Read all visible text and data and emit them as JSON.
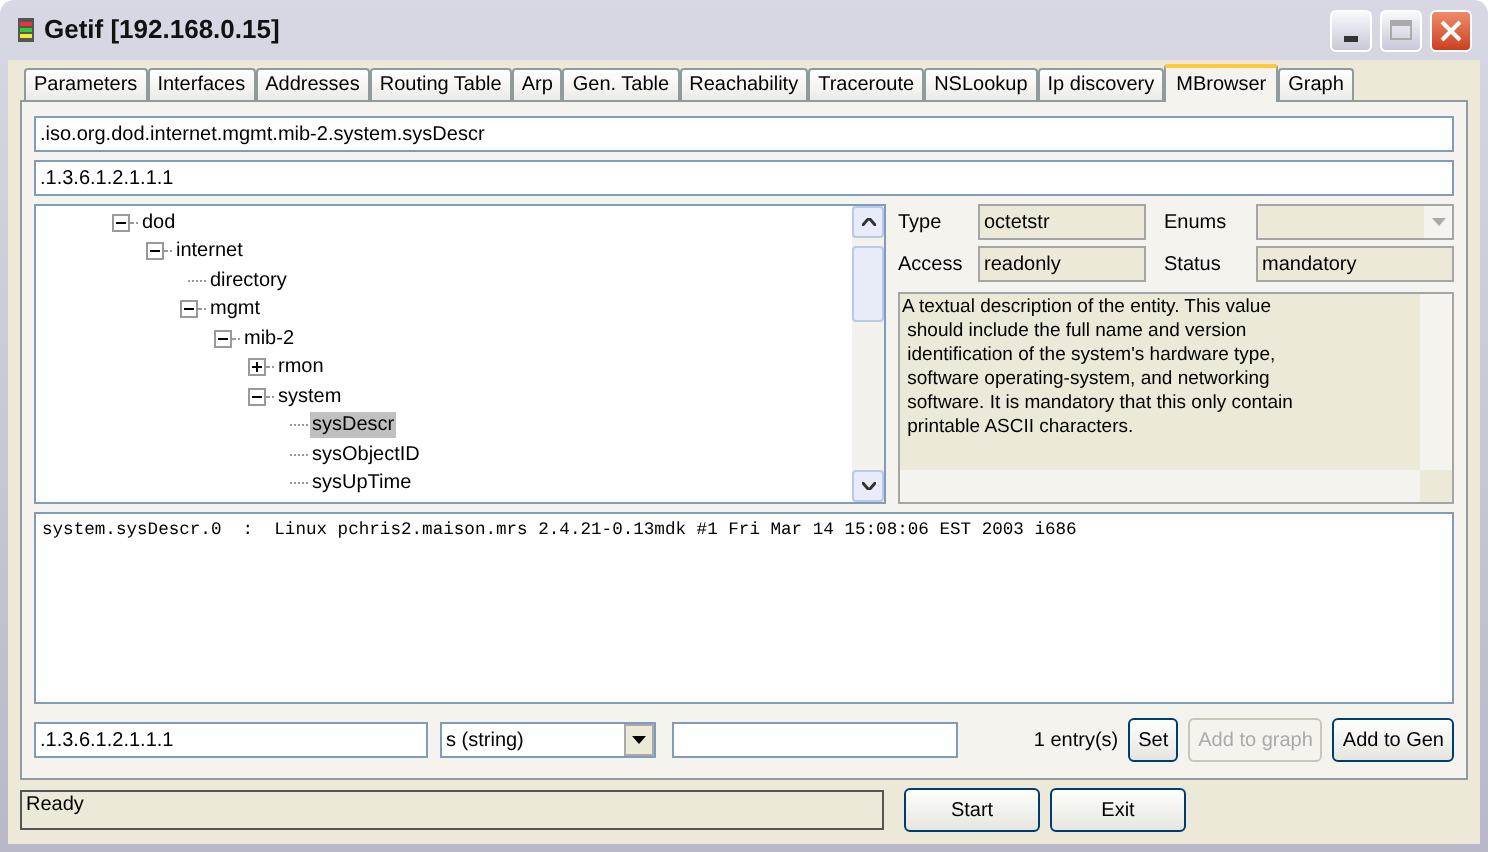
{
  "window": {
    "title": "Getif [192.168.0.15]"
  },
  "tabs": [
    {
      "label": "Parameters",
      "selected": false
    },
    {
      "label": "Interfaces",
      "selected": false
    },
    {
      "label": "Addresses",
      "selected": false
    },
    {
      "label": "Routing Table",
      "selected": false
    },
    {
      "label": "Arp",
      "selected": false
    },
    {
      "label": "Gen. Table",
      "selected": false
    },
    {
      "label": "Reachability",
      "selected": false
    },
    {
      "label": "Traceroute",
      "selected": false
    },
    {
      "label": "NSLookup",
      "selected": false
    },
    {
      "label": "Ip discovery",
      "selected": false
    },
    {
      "label": "MBrowser",
      "selected": true
    },
    {
      "label": "Graph",
      "selected": false
    }
  ],
  "path_field": {
    "value": ".iso.org.dod.internet.mgmt.mib-2.system.sysDescr"
  },
  "oid_field": {
    "value": ".1.3.6.1.2.1.1.1"
  },
  "tree": [
    {
      "label": "dod",
      "expanded": true,
      "selected": false,
      "children": [
        {
          "label": "internet",
          "expanded": true,
          "selected": false,
          "children": [
            {
              "label": "directory",
              "selected": false
            },
            {
              "label": "mgmt",
              "expanded": true,
              "selected": false,
              "children": [
                {
                  "label": "mib-2",
                  "expanded": true,
                  "selected": false,
                  "children": [
                    {
                      "label": "rmon",
                      "expanded": false,
                      "selected": false
                    },
                    {
                      "label": "system",
                      "expanded": true,
                      "selected": false,
                      "children": [
                        {
                          "label": "sysDescr",
                          "selected": true
                        },
                        {
                          "label": "sysObjectID",
                          "selected": false
                        },
                        {
                          "label": "sysUpTime",
                          "selected": false
                        }
                      ]
                    }
                  ]
                }
              ]
            }
          ]
        }
      ]
    }
  ],
  "details": {
    "type_label": "Type",
    "type_value": "octetstr",
    "enums_label": "Enums",
    "access_label": "Access",
    "access_value": "readonly",
    "status_label": "Status",
    "status_value": "mandatory",
    "description": "A textual description of the entity. This value\n should include the full name and version\n identification of the system's hardware type,\n software operating-system, and networking\n software. It is mandatory that this only contain\n printable ASCII characters."
  },
  "results": [
    "system.sysDescr.0  :  Linux pchris2.maison.mrs 2.4.21-0.13mdk #1 Fri Mar 14 15:08:06 EST 2003 i686"
  ],
  "set_row": {
    "oid_value": ".1.3.6.1.2.1.1.1",
    "type_value": "s (string)",
    "count": "1 entry(s)",
    "buttons": [
      {
        "label": "Set",
        "disabled": false
      },
      {
        "label": "Add to graph",
        "disabled": true
      },
      {
        "label": "Add to Gen",
        "disabled": false
      }
    ]
  },
  "status_bar": {
    "text": "Ready"
  },
  "footer_buttons": [
    "Start",
    "Exit"
  ]
}
